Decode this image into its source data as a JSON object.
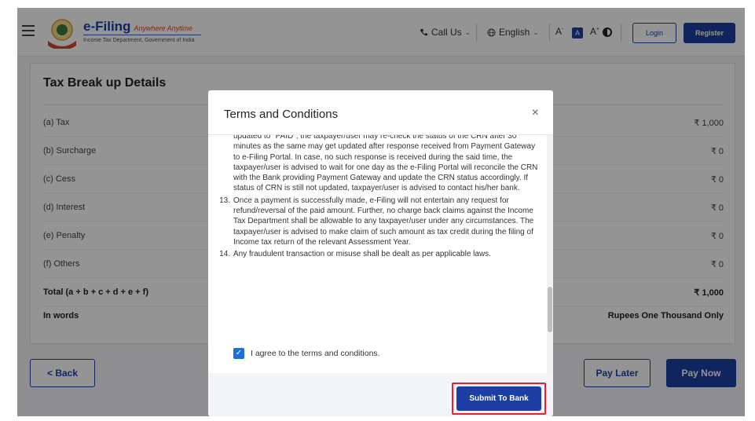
{
  "header": {
    "logo_title": "e-Filing",
    "logo_tagline": "Anywhere Anytime",
    "logo_subtitle": "Income Tax Department, Government of India",
    "call_us": "Call Us",
    "language": "English",
    "font_decrease": "A",
    "font_normal": "A",
    "font_increase": "A",
    "login": "Login",
    "register": "Register"
  },
  "card": {
    "title": "Tax Break up Details",
    "rows": [
      {
        "label": "(a) Tax",
        "value": "₹ 1,000"
      },
      {
        "label": "(b) Surcharge",
        "value": "₹ 0"
      },
      {
        "label": "(c) Cess",
        "value": "₹ 0"
      },
      {
        "label": "(d) Interest",
        "value": "₹ 0"
      },
      {
        "label": "(e) Penalty",
        "value": "₹ 0"
      },
      {
        "label": "(f) Others",
        "value": "₹ 0"
      }
    ],
    "total_label": "Total (a + b + c + d + e + f)",
    "total_value": "₹ 1,000",
    "words_label": "In words",
    "words_value": "Rupees One Thousand Only"
  },
  "actions": {
    "back": "< Back",
    "pay_later": "Pay Later",
    "pay_now": "Pay Now"
  },
  "modal": {
    "title": "Terms and Conditions",
    "close": "×",
    "term_12_cont": "updated to \"PAID\", the taxpayer/user may re-check the status of the CRN after 30 minutes as the same may get updated after response received from Payment Gateway to e-Filing Portal. In case, no such response is received during the said time, the taxpayer/user is advised to wait for one day as the e-Filing Portal will reconcile the CRN with the Bank providing Payment Gateway and update the CRN status accordingly. If status of CRN is still not updated, taxpayer/user is advised to contact his/her bank.",
    "term_13_num": "13.",
    "term_13": "Once a payment is successfully made, e-Filing will not entertain any request for refund/reversal of the paid amount. Further, no charge back claims against the Income Tax Department shall be allowable to any taxpayer/user under any circumstances. The taxpayer/user is advised to make claim of such amount as tax credit during the filing of Income tax return of the relevant Assessment Year.",
    "term_14_num": "14.",
    "term_14": "Any fraudulent transaction or misuse shall be dealt as per applicable laws.",
    "agree_label": "I agree to the terms and conditions.",
    "agree_checked": true,
    "submit": "Submit To Bank"
  },
  "colors": {
    "primary": "#1d3fa3",
    "highlight": "#e8202e",
    "checkbox": "#1d6fdc"
  }
}
